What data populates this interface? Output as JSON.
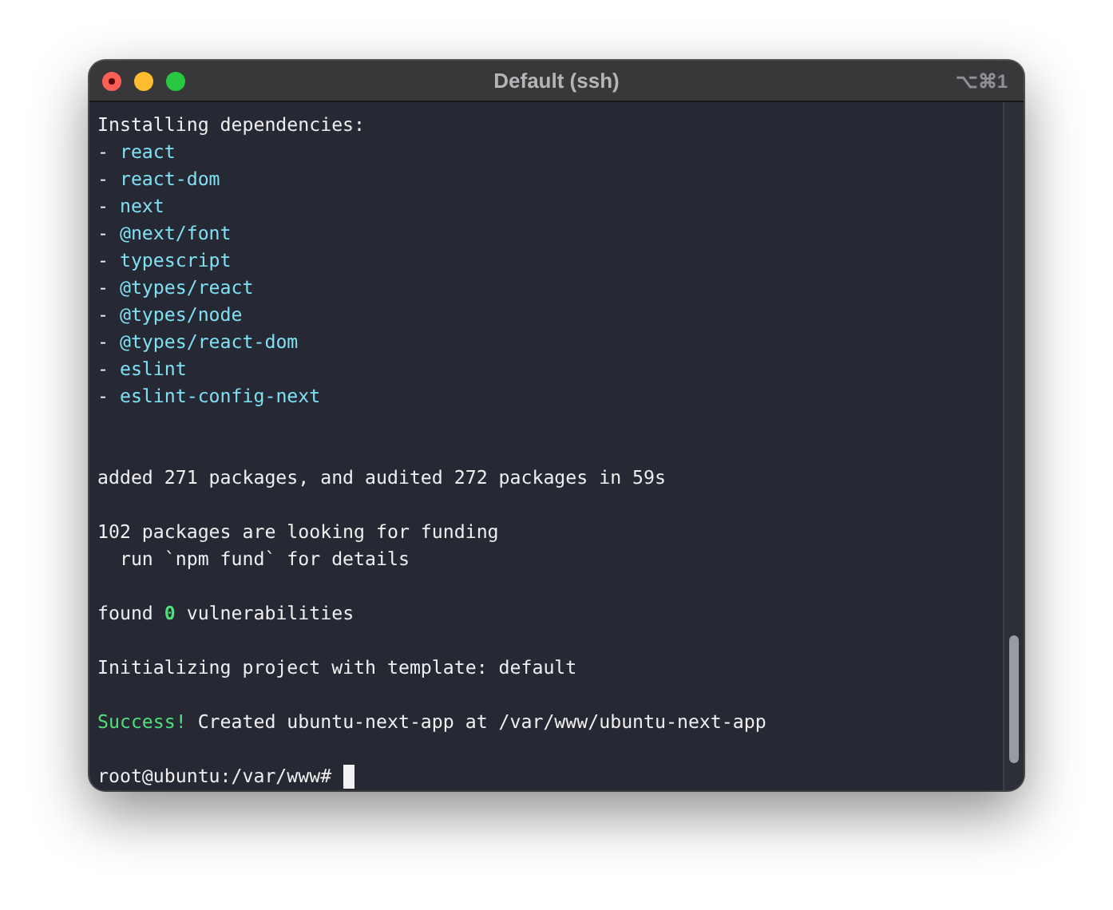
{
  "window": {
    "title": "Default (ssh)",
    "shortcut": "⌥⌘1"
  },
  "terminal": {
    "lines": [
      {
        "segments": [
          {
            "text": "Installing dependencies:",
            "kind": "plain"
          }
        ]
      },
      {
        "segments": [
          {
            "text": "- ",
            "kind": "plain"
          },
          {
            "text": "react",
            "kind": "package"
          }
        ]
      },
      {
        "segments": [
          {
            "text": "- ",
            "kind": "plain"
          },
          {
            "text": "react-dom",
            "kind": "package"
          }
        ]
      },
      {
        "segments": [
          {
            "text": "- ",
            "kind": "plain"
          },
          {
            "text": "next",
            "kind": "package"
          }
        ]
      },
      {
        "segments": [
          {
            "text": "- ",
            "kind": "plain"
          },
          {
            "text": "@next/font",
            "kind": "package"
          }
        ]
      },
      {
        "segments": [
          {
            "text": "- ",
            "kind": "plain"
          },
          {
            "text": "typescript",
            "kind": "package"
          }
        ]
      },
      {
        "segments": [
          {
            "text": "- ",
            "kind": "plain"
          },
          {
            "text": "@types/react",
            "kind": "package"
          }
        ]
      },
      {
        "segments": [
          {
            "text": "- ",
            "kind": "plain"
          },
          {
            "text": "@types/node",
            "kind": "package"
          }
        ]
      },
      {
        "segments": [
          {
            "text": "- ",
            "kind": "plain"
          },
          {
            "text": "@types/react-dom",
            "kind": "package"
          }
        ]
      },
      {
        "segments": [
          {
            "text": "- ",
            "kind": "plain"
          },
          {
            "text": "eslint",
            "kind": "package"
          }
        ]
      },
      {
        "segments": [
          {
            "text": "- ",
            "kind": "plain"
          },
          {
            "text": "eslint-config-next",
            "kind": "package"
          }
        ]
      },
      {
        "kind": "blank"
      },
      {
        "kind": "blank"
      },
      {
        "segments": [
          {
            "text": "added 271 packages, and audited 272 packages in 59s",
            "kind": "plain"
          }
        ]
      },
      {
        "kind": "blank"
      },
      {
        "segments": [
          {
            "text": "102 packages are looking for funding",
            "kind": "plain"
          }
        ]
      },
      {
        "segments": [
          {
            "text": "  run `npm fund` for details",
            "kind": "plain"
          }
        ]
      },
      {
        "kind": "blank"
      },
      {
        "segments": [
          {
            "text": "found ",
            "kind": "plain"
          },
          {
            "text": "0",
            "kind": "count"
          },
          {
            "text": " vulnerabilities",
            "kind": "plain"
          }
        ]
      },
      {
        "kind": "blank"
      },
      {
        "segments": [
          {
            "text": "Initializing project with template: default",
            "kind": "plain"
          }
        ]
      },
      {
        "kind": "blank"
      },
      {
        "segments": [
          {
            "text": "Success!",
            "kind": "success"
          },
          {
            "text": " Created ubuntu-next-app at /var/www/ubuntu-next-app",
            "kind": "plain"
          }
        ]
      },
      {
        "kind": "blank"
      },
      {
        "segments": [
          {
            "text": "root@ubuntu:/var/www# ",
            "kind": "plain"
          }
        ],
        "cursor": true
      }
    ]
  }
}
